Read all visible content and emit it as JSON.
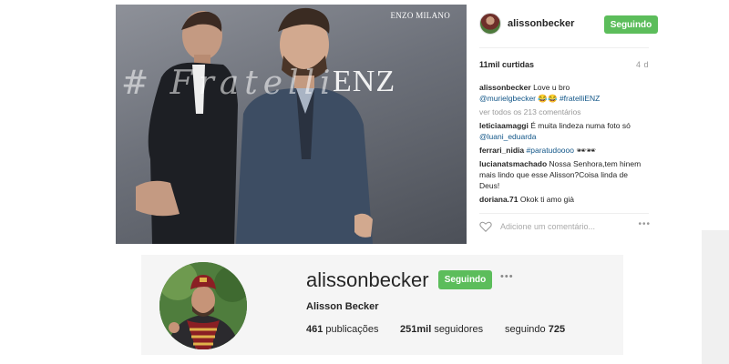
{
  "post": {
    "brand_mark": "ENZO MILANO",
    "watermark_hashtag": "# Fratelli",
    "watermark_brand": "ENZ"
  },
  "post_panel": {
    "username": "alissonbecker",
    "follow_label": "Seguindo",
    "likes": "11mil curtidas",
    "time": "4 d",
    "caption": {
      "user": "alissonbecker",
      "text": "Love u bro",
      "mention": "@murielgbecker",
      "emoji": "😂😂",
      "hashtag": "#fratelliENZ"
    },
    "view_all": "ver todos os 213 comentários",
    "comments": [
      {
        "user": "leticiaamaggi",
        "text": "É muita lindeza numa foto só",
        "mention": "@luani_eduarda"
      },
      {
        "user": "ferrari_nidia",
        "text": "",
        "hashtag": "#paratudoooo",
        "emoji": "🕶🕶"
      },
      {
        "user": "lucianatsmachado",
        "text": "Nossa Senhora,tem hinem mais lindo que esse Alisson?Coisa linda de Deus!"
      },
      {
        "user": "doriana.71",
        "text": "Okok ti amo già"
      }
    ],
    "add_comment_placeholder": "Adicione um comentário...",
    "icons": {
      "like": "heart-icon",
      "more": "more-options-icon"
    }
  },
  "profile": {
    "username": "alissonbecker",
    "follow_label": "Seguindo",
    "full_name": "Alisson Becker",
    "stats": {
      "posts_count": "461",
      "posts_label": "publicações",
      "followers_count": "251mil",
      "followers_label": "seguidores",
      "following_label": "seguindo",
      "following_count": "725"
    }
  },
  "colors": {
    "follow_button": "#5cbd5b",
    "link": "#125688",
    "muted": "#999999",
    "profile_background": "#f5f5f5"
  }
}
